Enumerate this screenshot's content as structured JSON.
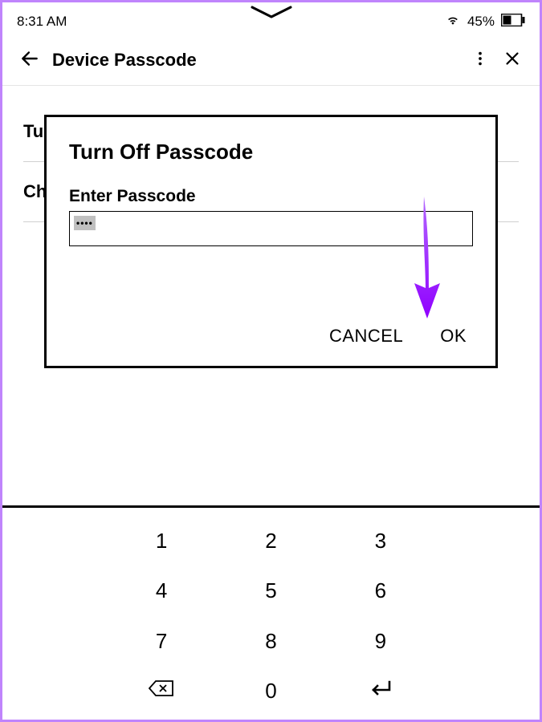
{
  "status": {
    "time": "8:31 AM",
    "battery_pct": "45%"
  },
  "appbar": {
    "title": "Device Passcode"
  },
  "background_rows": {
    "row0": "Tu",
    "row1": "Ch"
  },
  "dialog": {
    "title": "Turn Off Passcode",
    "field_label": "Enter Passcode",
    "input_value": "••••",
    "cancel_label": "CANCEL",
    "ok_label": "OK"
  },
  "keypad": {
    "k1": "1",
    "k2": "2",
    "k3": "3",
    "k4": "4",
    "k5": "5",
    "k6": "6",
    "k7": "7",
    "k8": "8",
    "k9": "9",
    "k0": "0"
  }
}
